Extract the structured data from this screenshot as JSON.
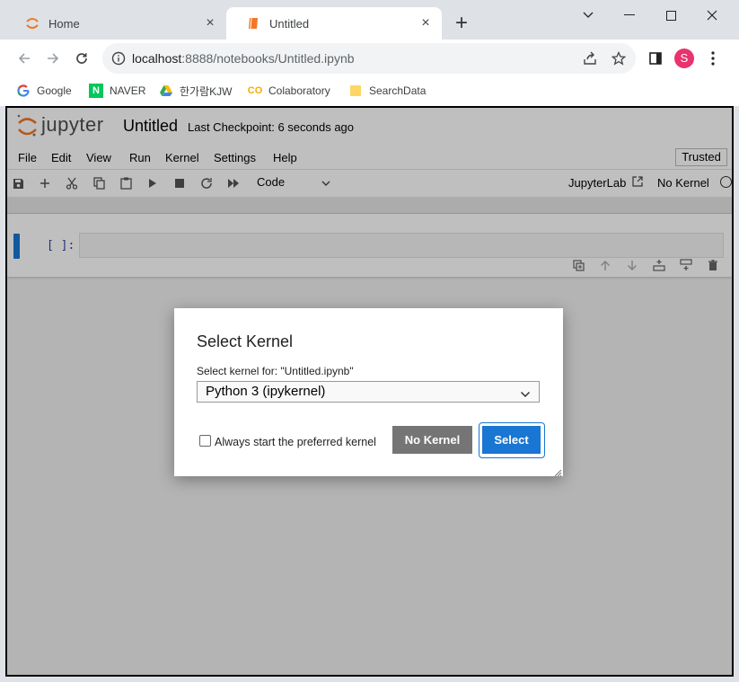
{
  "browser": {
    "tabs": [
      {
        "title": "Home",
        "icon": "jupyter-icon",
        "active": false
      },
      {
        "title": "Untitled",
        "icon": "notebook-icon",
        "active": true
      }
    ],
    "url_host": "localhost",
    "url_rest": ":8888/notebooks/Untitled.ipynb",
    "profile_initial": "S",
    "bookmarks": [
      {
        "label": "Google",
        "icon": "google-icon"
      },
      {
        "label": "NAVER",
        "icon": "naver-icon",
        "glyph": "N"
      },
      {
        "label": "한가람KJW",
        "icon": "google-drive-icon"
      },
      {
        "label": "Colaboratory",
        "icon": "colab-icon",
        "glyph": "CO"
      },
      {
        "label": "SearchData",
        "icon": "folder-icon"
      }
    ]
  },
  "jupyter": {
    "logo_text": "jupyter",
    "notebook_title": "Untitled",
    "checkpoint": "Last Checkpoint: 6 seconds ago",
    "menu": [
      "File",
      "Edit",
      "View",
      "Run",
      "Kernel",
      "Settings",
      "Help"
    ],
    "trusted": "Trusted",
    "cell_type": "Code",
    "jupyterlab_link": "JupyterLab",
    "kernel_status": "No Kernel",
    "cell_prompt": "[ ]:"
  },
  "dialog": {
    "title": "Select Kernel",
    "label": "Select kernel for: \"Untitled.ipynb\"",
    "selected_kernel": "Python 3 (ipykernel)",
    "checkbox_label": "Always start the preferred kernel",
    "checkbox_checked": false,
    "no_kernel_button": "No Kernel",
    "select_button": "Select"
  },
  "colors": {
    "accent": "#1976d2",
    "secondary_button": "#757575",
    "jupyter_orange": "#f37726",
    "profile": "#e8336e"
  }
}
